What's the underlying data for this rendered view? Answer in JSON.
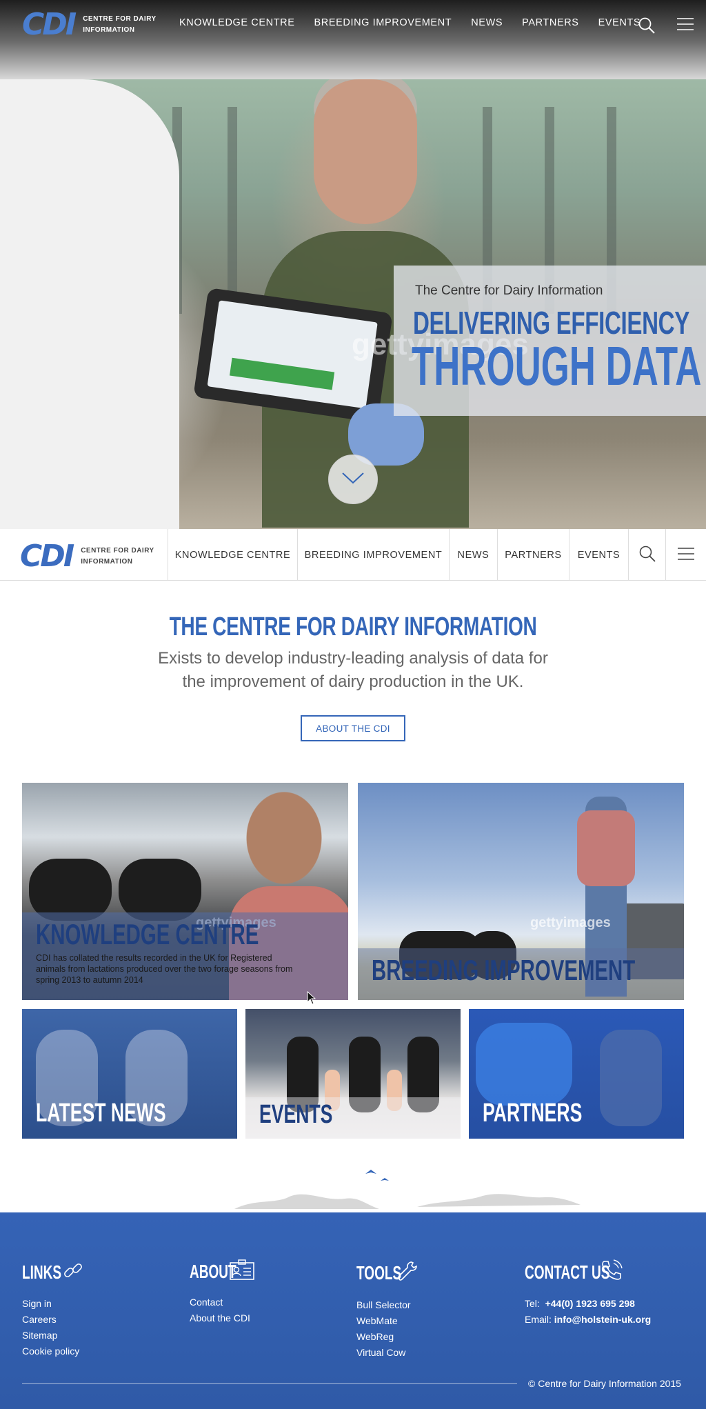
{
  "brand": {
    "mark": "CDI",
    "name_line1": "CENTRE FOR DAIRY",
    "name_line2": "INFORMATION",
    "colors": {
      "primary": "#3466b8",
      "footer": "#2f5aa7",
      "accent_light": "#4a7ed0"
    }
  },
  "nav": {
    "items": [
      "KNOWLEDGE CENTRE",
      "BREEDING IMPROVEMENT",
      "NEWS",
      "PARTNERS",
      "EVENTS"
    ],
    "search_icon": "search-icon",
    "menu_icon": "hamburger-menu-icon"
  },
  "hero": {
    "intro": "The Centre for Dairy Information",
    "headline_1": "DELIVERING EFFICIENCY",
    "headline_2": "THROUGH DATA",
    "watermark": "gettyimages",
    "scroll_icon": "chevron-down-icon"
  },
  "intro": {
    "title": "THE CENTRE FOR DAIRY INFORMATION",
    "description": "Exists to develop industry-leading analysis of data for the improvement of dairy production in the UK.",
    "button": "ABOUT THE CDI"
  },
  "tiles": {
    "knowledge_centre": {
      "title": "KNOWLEDGE CENTRE",
      "description": "CDI has collated the results recorded in the UK for Registered animals from lactations produced over the two forage seasons from spring 2013 to autumn 2014",
      "watermark": "gettyimages"
    },
    "breeding_improvement": {
      "title": "BREEDING IMPROVEMENT",
      "watermark": "gettyimages"
    },
    "latest_news": {
      "title": "LATEST NEWS"
    },
    "events": {
      "title": "EVENTS"
    },
    "partners": {
      "title": "PARTNERS"
    }
  },
  "footer": {
    "links": {
      "title": "LINKS",
      "icon": "link-icon",
      "items": [
        "Sign in",
        "Careers",
        "Sitemap",
        "Cookie policy"
      ]
    },
    "about": {
      "title": "ABOUT",
      "icon": "id-card-icon",
      "items": [
        "Contact",
        "About the CDI"
      ]
    },
    "tools": {
      "title": "TOOLS",
      "icon": "wrench-icon",
      "items": [
        "Bull Selector",
        "WebMate",
        "WebReg",
        "Virtual Cow"
      ]
    },
    "contact": {
      "title": "CONTACT US",
      "icon": "phone-icon",
      "tel_label": "Tel:",
      "tel": "+44(0) 1923 695 298",
      "email_label": "Email:",
      "email": "info@holstein-uk.org"
    },
    "copyright": "© Centre for Dairy Information 2015"
  }
}
